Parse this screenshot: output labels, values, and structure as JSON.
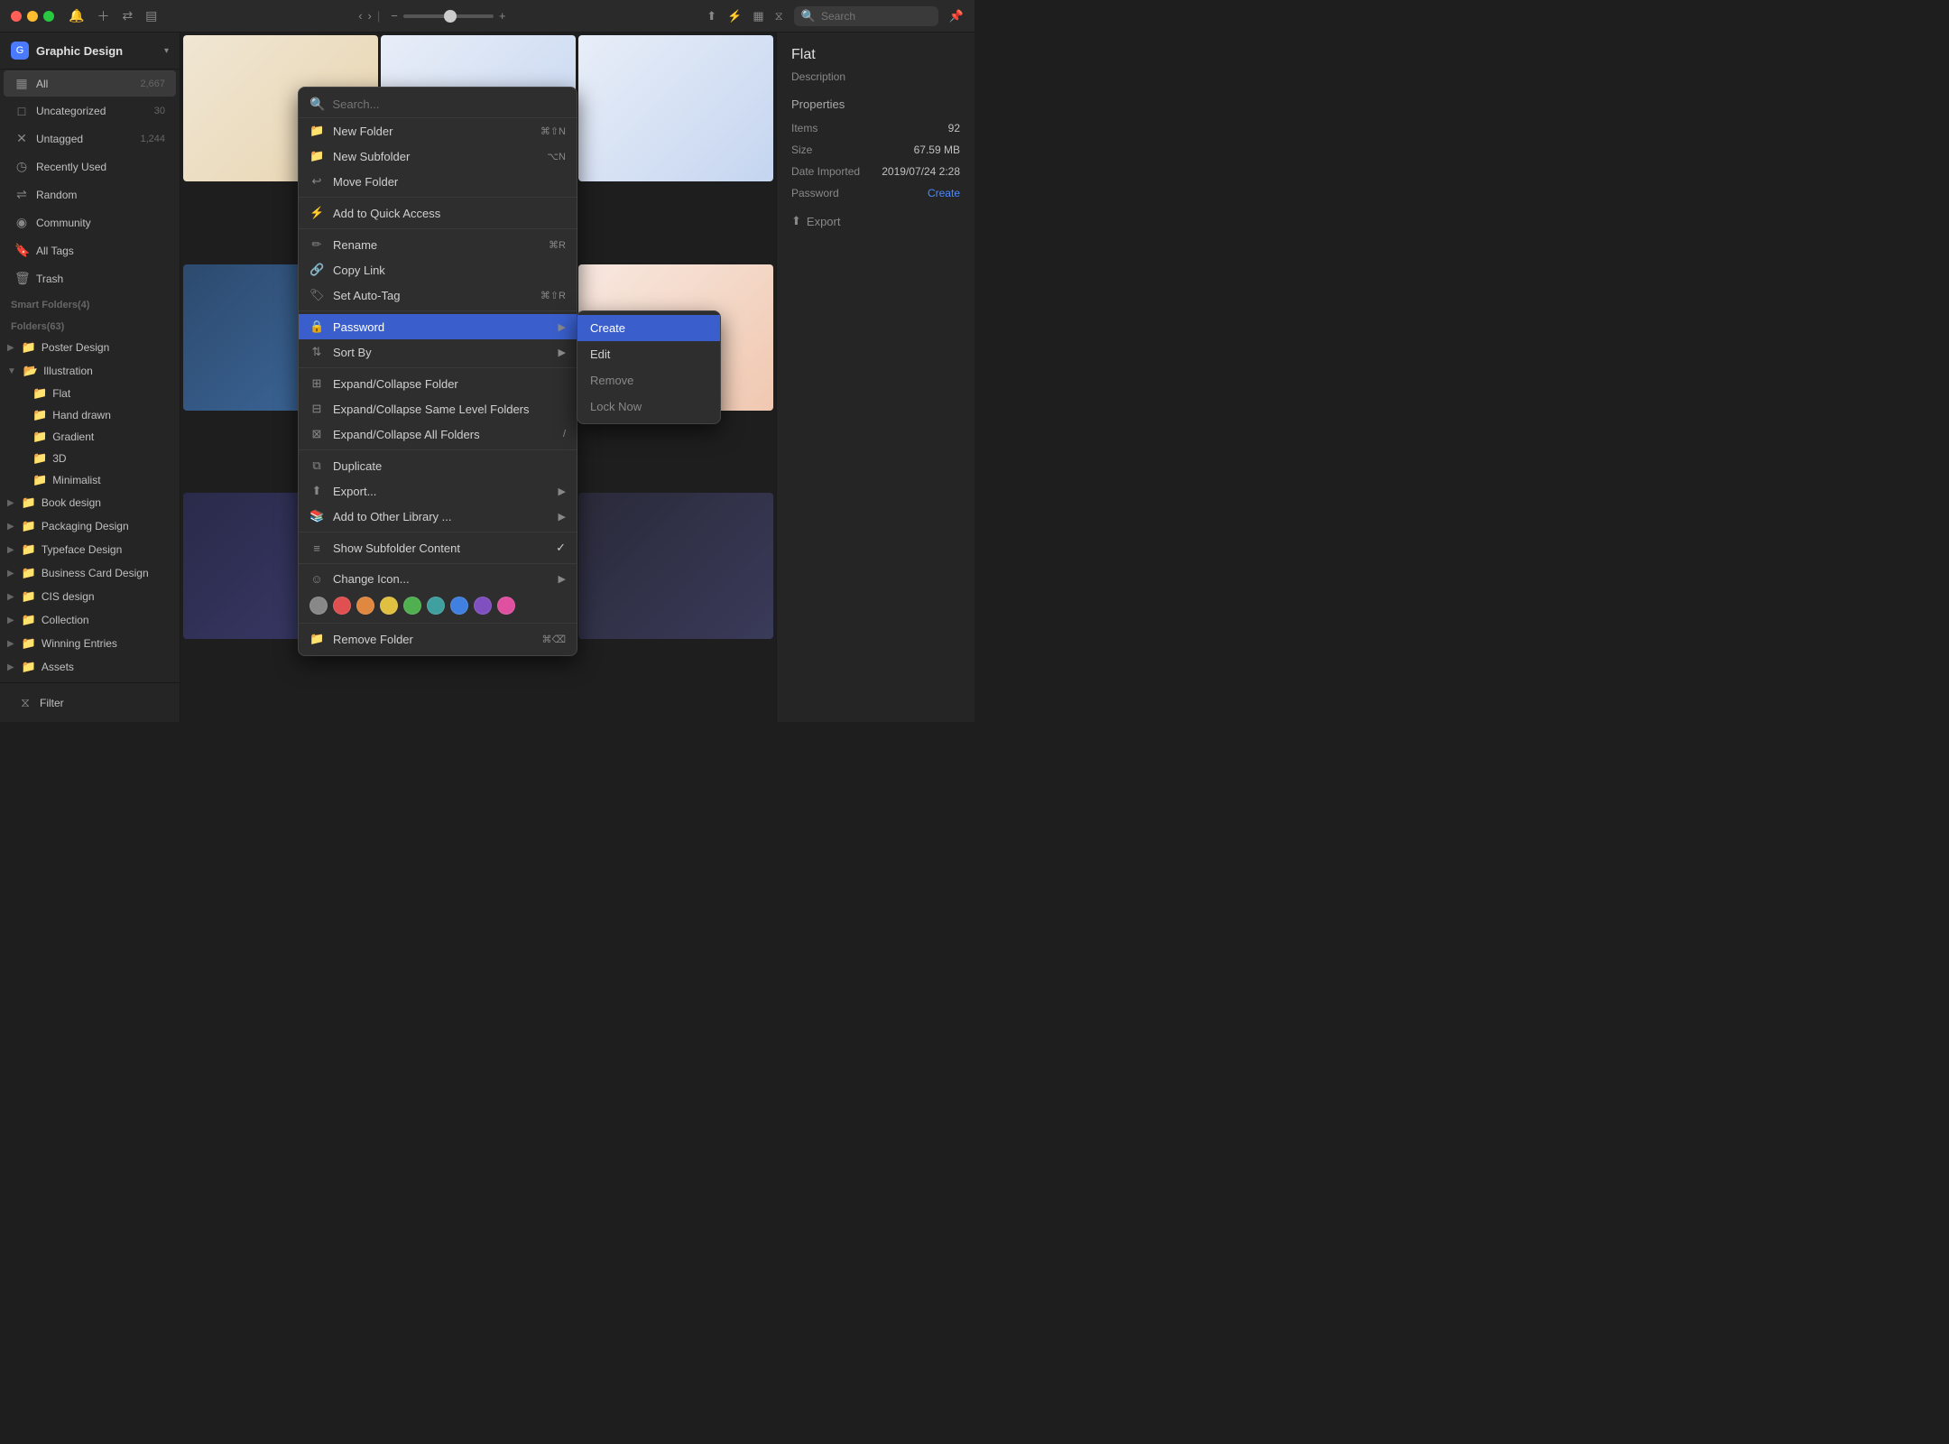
{
  "titlebar": {
    "app_title": "Graphic Design",
    "search_placeholder": "Search"
  },
  "sidebar": {
    "header_title": "Graphic Design",
    "items": [
      {
        "label": "All",
        "count": "2,667",
        "icon": "grid"
      },
      {
        "label": "Uncategorized",
        "count": "30",
        "icon": "box"
      },
      {
        "label": "Untagged",
        "count": "1,244",
        "icon": "tag"
      },
      {
        "label": "Recently Used",
        "count": "",
        "icon": "clock"
      },
      {
        "label": "Random",
        "count": "",
        "icon": "shuffle"
      },
      {
        "label": "Community",
        "count": "",
        "icon": "globe"
      },
      {
        "label": "All Tags",
        "count": "",
        "icon": "bookmark"
      },
      {
        "label": "Trash",
        "count": "",
        "icon": "trash"
      }
    ],
    "smart_folders_label": "Smart Folders(4)",
    "folders_label": "Folders(63)",
    "folders": [
      {
        "label": "Poster Design",
        "icon": "folder",
        "color": "orange",
        "expanded": false
      },
      {
        "label": "Illustration",
        "icon": "folder",
        "color": "orange",
        "expanded": true
      },
      {
        "label": "Flat",
        "icon": "folder",
        "color": "yellow",
        "sub": true
      },
      {
        "label": "Hand drawn",
        "icon": "folder",
        "color": "yellow",
        "sub": true
      },
      {
        "label": "Gradient",
        "icon": "folder",
        "color": "yellow",
        "sub": true
      },
      {
        "label": "3D",
        "icon": "folder",
        "color": "yellow",
        "sub": true
      },
      {
        "label": "Minimalist",
        "icon": "folder",
        "color": "yellow",
        "sub": true
      },
      {
        "label": "Book design",
        "icon": "folder",
        "color": "orange",
        "expanded": false
      },
      {
        "label": "Packaging Design",
        "icon": "folder",
        "color": "orange",
        "expanded": false
      },
      {
        "label": "Typeface Design",
        "icon": "folder",
        "color": "orange",
        "expanded": false
      },
      {
        "label": "Business Card Design",
        "icon": "folder",
        "color": "orange",
        "expanded": false
      },
      {
        "label": "CIS design",
        "icon": "folder",
        "color": "orange",
        "expanded": false
      },
      {
        "label": "Collection",
        "icon": "folder",
        "color": "orange",
        "expanded": false
      },
      {
        "label": "Winning Entries",
        "icon": "folder",
        "color": "orange",
        "expanded": false
      },
      {
        "label": "Assets",
        "icon": "folder",
        "color": "orange",
        "expanded": false
      }
    ],
    "filter_label": "Filter"
  },
  "right_panel": {
    "title": "Flat",
    "description": "Description",
    "properties_label": "Properties",
    "items_label": "Items",
    "items_value": "92",
    "size_label": "Size",
    "size_value": "67.59 MB",
    "date_imported_label": "Date Imported",
    "date_imported_value": "2019/07/24 2:28",
    "password_label": "Password",
    "password_value": "Create",
    "export_label": "Export"
  },
  "context_menu": {
    "search_placeholder": "Search...",
    "items": [
      {
        "label": "New Folder",
        "icon": "folder-plus",
        "shortcut": "⌘⇧N",
        "has_arrow": false
      },
      {
        "label": "New Subfolder",
        "icon": "folder-plus",
        "shortcut": "⌥N",
        "has_arrow": false
      },
      {
        "label": "Move Folder",
        "icon": "move",
        "shortcut": "",
        "has_arrow": false
      },
      {
        "label": "Add to Quick Access",
        "icon": "bolt",
        "shortcut": "",
        "has_arrow": false
      },
      {
        "label": "Rename",
        "icon": "edit",
        "shortcut": "⌘R",
        "has_arrow": false
      },
      {
        "label": "Copy Link",
        "icon": "link",
        "shortcut": "",
        "has_arrow": false
      },
      {
        "label": "Set Auto-Tag",
        "icon": "tag",
        "shortcut": "⌘⇧R",
        "has_arrow": false
      },
      {
        "label": "Password",
        "icon": "lock",
        "shortcut": "",
        "has_arrow": true,
        "highlighted": true
      },
      {
        "label": "Sort By",
        "icon": "sort",
        "shortcut": "",
        "has_arrow": true
      },
      {
        "label": "Expand/Collapse Folder",
        "icon": "expand",
        "shortcut": "",
        "has_arrow": false
      },
      {
        "label": "Expand/Collapse Same Level Folders",
        "icon": "expand-all",
        "shortcut": "",
        "has_arrow": false
      },
      {
        "label": "Expand/Collapse All Folders",
        "icon": "expand-all",
        "shortcut": "/",
        "has_arrow": false
      },
      {
        "label": "Duplicate",
        "icon": "copy",
        "shortcut": "",
        "has_arrow": false
      },
      {
        "label": "Export...",
        "icon": "export",
        "shortcut": "",
        "has_arrow": true
      },
      {
        "label": "Add to Other Library ...",
        "icon": "library",
        "shortcut": "",
        "has_arrow": true
      },
      {
        "label": "Show Subfolder Content",
        "icon": "list",
        "shortcut": "",
        "has_arrow": false,
        "checked": true
      },
      {
        "label": "Change Icon...",
        "icon": "smiley",
        "shortcut": "",
        "has_arrow": true
      },
      {
        "label": "Remove Folder",
        "icon": "folder-minus",
        "shortcut": "⌘⌫",
        "has_arrow": false
      }
    ],
    "password_submenu": [
      {
        "label": "Create",
        "active": true
      },
      {
        "label": "Edit",
        "active": false
      },
      {
        "label": "Remove",
        "active": false,
        "dimmed": true
      },
      {
        "label": "Lock Now",
        "active": false,
        "dimmed": true
      }
    ],
    "colors": [
      {
        "name": "gray",
        "hex": "#888888"
      },
      {
        "name": "red",
        "hex": "#e05050"
      },
      {
        "name": "orange",
        "hex": "#e08840"
      },
      {
        "name": "yellow",
        "hex": "#e0c040"
      },
      {
        "name": "green",
        "hex": "#50b050"
      },
      {
        "name": "teal",
        "hex": "#40a0a0"
      },
      {
        "name": "blue",
        "hex": "#4080e0"
      },
      {
        "name": "purple",
        "hex": "#8050c0"
      },
      {
        "name": "pink",
        "hex": "#e050a0"
      }
    ]
  },
  "images": [
    {
      "color": "ill-1"
    },
    {
      "color": "ill-2"
    },
    {
      "color": "ill-3"
    },
    {
      "color": "ill-4"
    },
    {
      "color": "ill-5"
    },
    {
      "color": "ill-6"
    },
    {
      "color": "ill-7"
    },
    {
      "color": "ill-8"
    },
    {
      "color": "ill-9"
    }
  ]
}
